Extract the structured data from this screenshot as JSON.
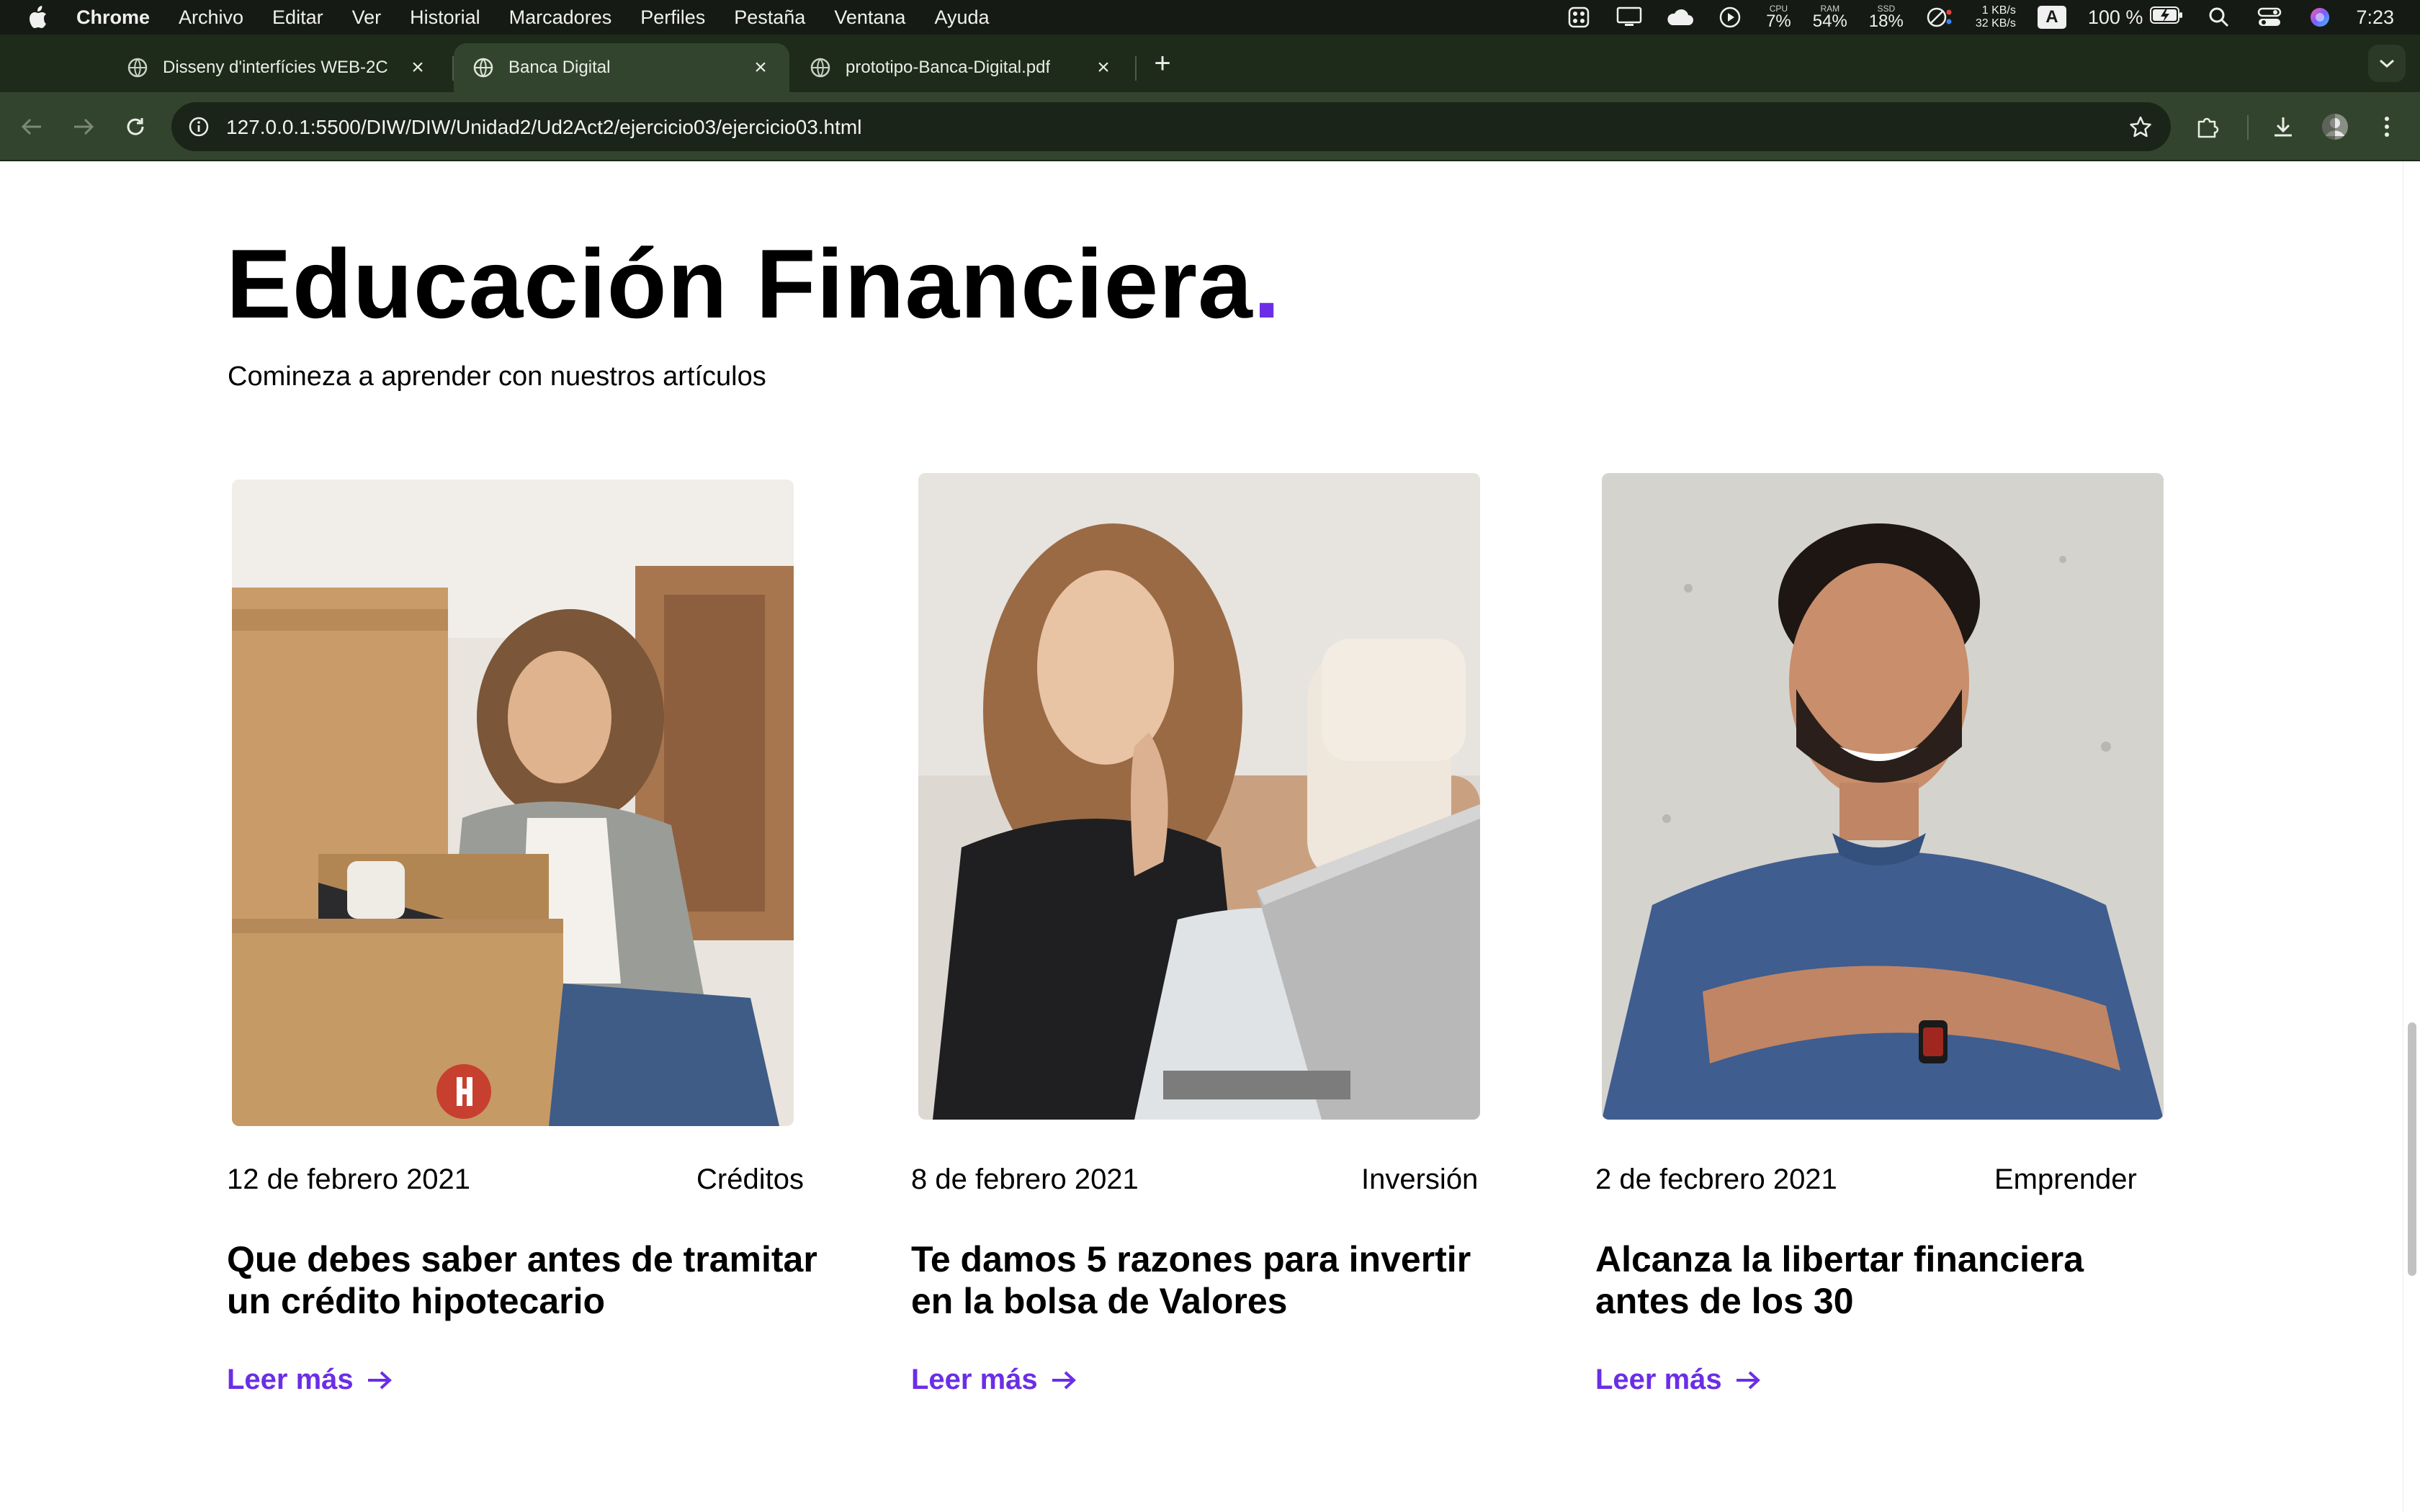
{
  "menubar": {
    "app": "Chrome",
    "items": [
      "Archivo",
      "Editar",
      "Ver",
      "Historial",
      "Marcadores",
      "Perfiles",
      "Pestaña",
      "Ventana",
      "Ayuda"
    ],
    "status": {
      "cpu_label": "CPU",
      "cpu_value": "7%",
      "ram_label": "RAM",
      "ram_value": "54%",
      "ssd_label": "SSD",
      "ssd_value": "18%",
      "net_down": "1 KB/s",
      "net_up": "32 KB/s",
      "input_source": "A",
      "battery": "100 %",
      "time": "7:23"
    }
  },
  "tabs": [
    {
      "title": "Disseny d'interfícies WEB-2C",
      "active": false,
      "favicon": "globe-icon"
    },
    {
      "title": "Banca Digital",
      "active": true,
      "favicon": "globe-icon"
    },
    {
      "title": "prototipo-Banca-Digital.pdf",
      "active": false,
      "favicon": "globe-icon"
    }
  ],
  "omnibox": {
    "url": "127.0.0.1:5500/DIW/DIW/Unidad2/Ud2Act2/ejercicio03/ejercicio03.html"
  },
  "page": {
    "heading": "Educación Financiera",
    "heading_dot": ".",
    "subheading": "Comineza a aprender con nuestros artículos",
    "accent": "#6b2ee6",
    "articles": [
      {
        "image": "woman-with-laptop-and-boxes",
        "date": "12 de febrero 2021",
        "category": "Créditos",
        "title": "Que debes saber antes de tramitar un crédito hipotecario",
        "link": "Leer más"
      },
      {
        "image": "woman-resting-chin-on-hand",
        "date": "8 de febrero 2021",
        "category": "Inversión",
        "title": "Te damos 5 razones para invertir en la bolsa de Valores",
        "link": "Leer más"
      },
      {
        "image": "smiling-man-arms-crossed",
        "date": "2 de fecbrero 2021",
        "category": "Emprender",
        "title": "Alcanza la libertar financiera antes de los 30",
        "link": "Leer más"
      }
    ]
  }
}
